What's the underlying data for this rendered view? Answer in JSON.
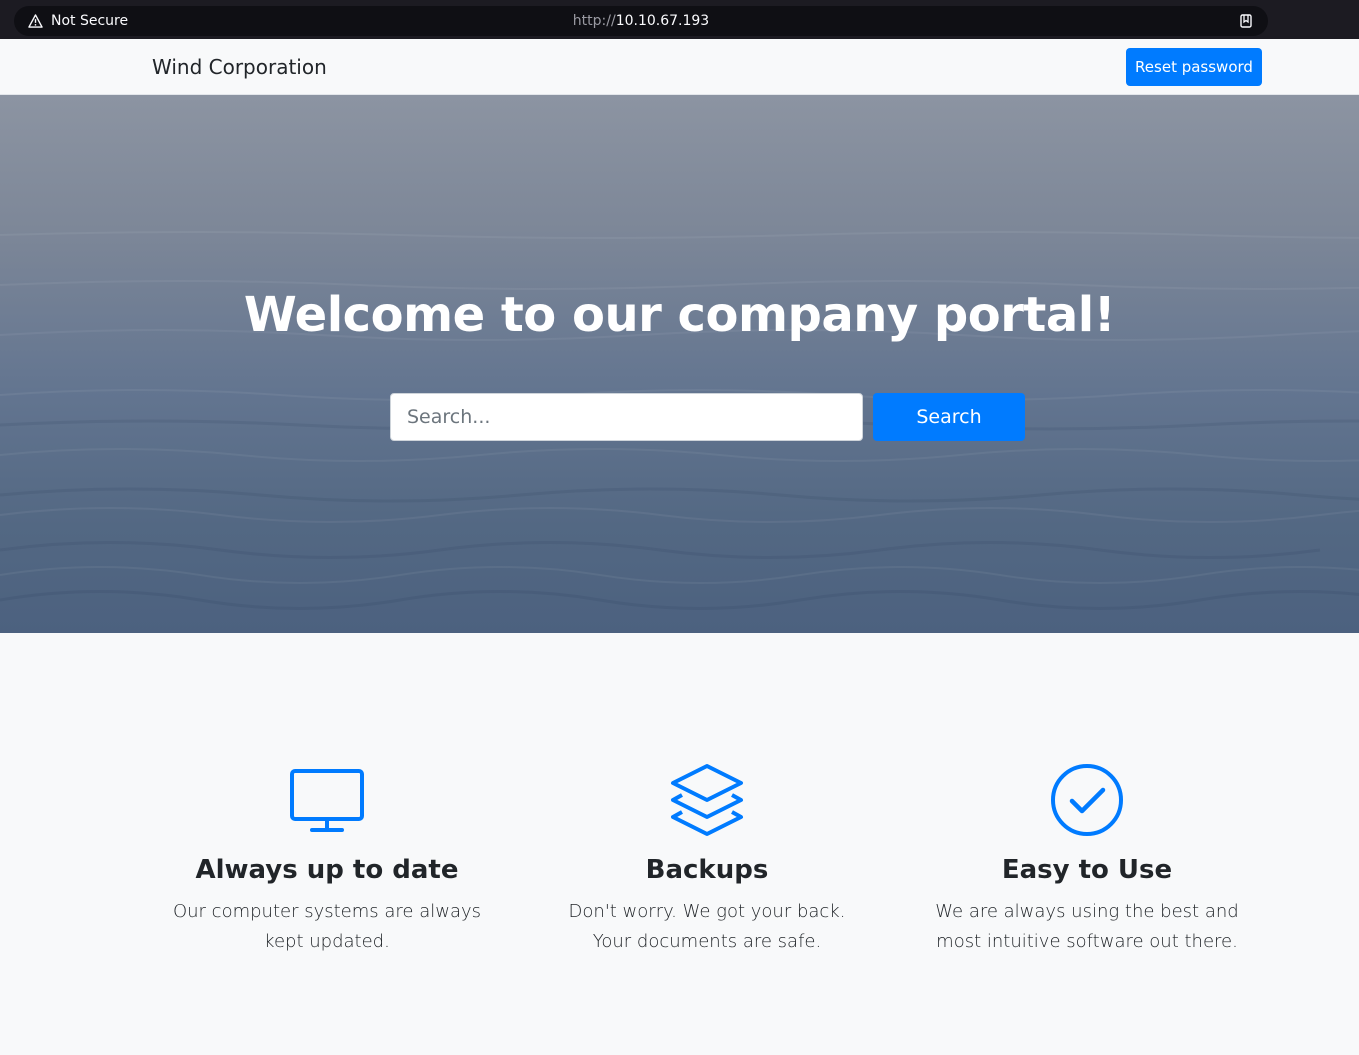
{
  "browser": {
    "security_label": "Not Secure",
    "url_protocol": "http://",
    "url_host": "10.10.67.193"
  },
  "navbar": {
    "brand": "Wind Corporation",
    "reset_button": "Reset password"
  },
  "hero": {
    "title": "Welcome to our company portal!",
    "search_placeholder": "Search...",
    "search_button": "Search"
  },
  "features": [
    {
      "icon": "monitor-icon",
      "title": "Always up to date",
      "text": "Our computer systems are always kept updated."
    },
    {
      "icon": "layers-icon",
      "title": "Backups",
      "text": "Don't worry. We got your back. Your documents are safe."
    },
    {
      "icon": "check-circle-icon",
      "title": "Easy to Use",
      "text": "We are always using the best and most intuitive software out there."
    }
  ],
  "colors": {
    "accent": "#007bff",
    "browser_bg": "#1c1b22",
    "page_bg": "#f8f9fa"
  }
}
